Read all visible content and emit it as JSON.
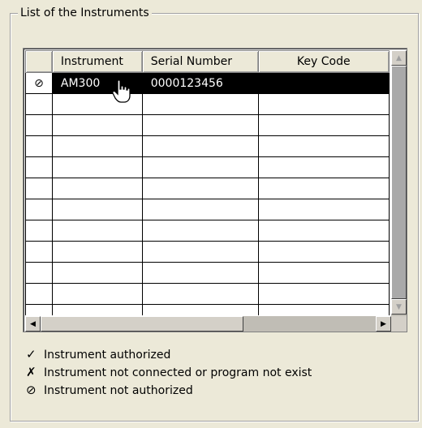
{
  "group": {
    "title": "List of the Instruments"
  },
  "grid": {
    "columns": [
      "",
      "Instrument",
      "Serial Number",
      "Key Code"
    ],
    "rows": [
      {
        "status_icon": "⊘",
        "instrument": "AM300",
        "serial": "0000123456",
        "key": ""
      }
    ]
  },
  "legend": [
    {
      "icon": "✓",
      "label": "Instrument authorized"
    },
    {
      "icon": "✗",
      "label": "Instrument not connected or program not exist"
    },
    {
      "icon": "⊘",
      "label": "Instrument not authorized"
    }
  ],
  "colors": {
    "selection": "#000000",
    "background": "#ece9d8"
  }
}
